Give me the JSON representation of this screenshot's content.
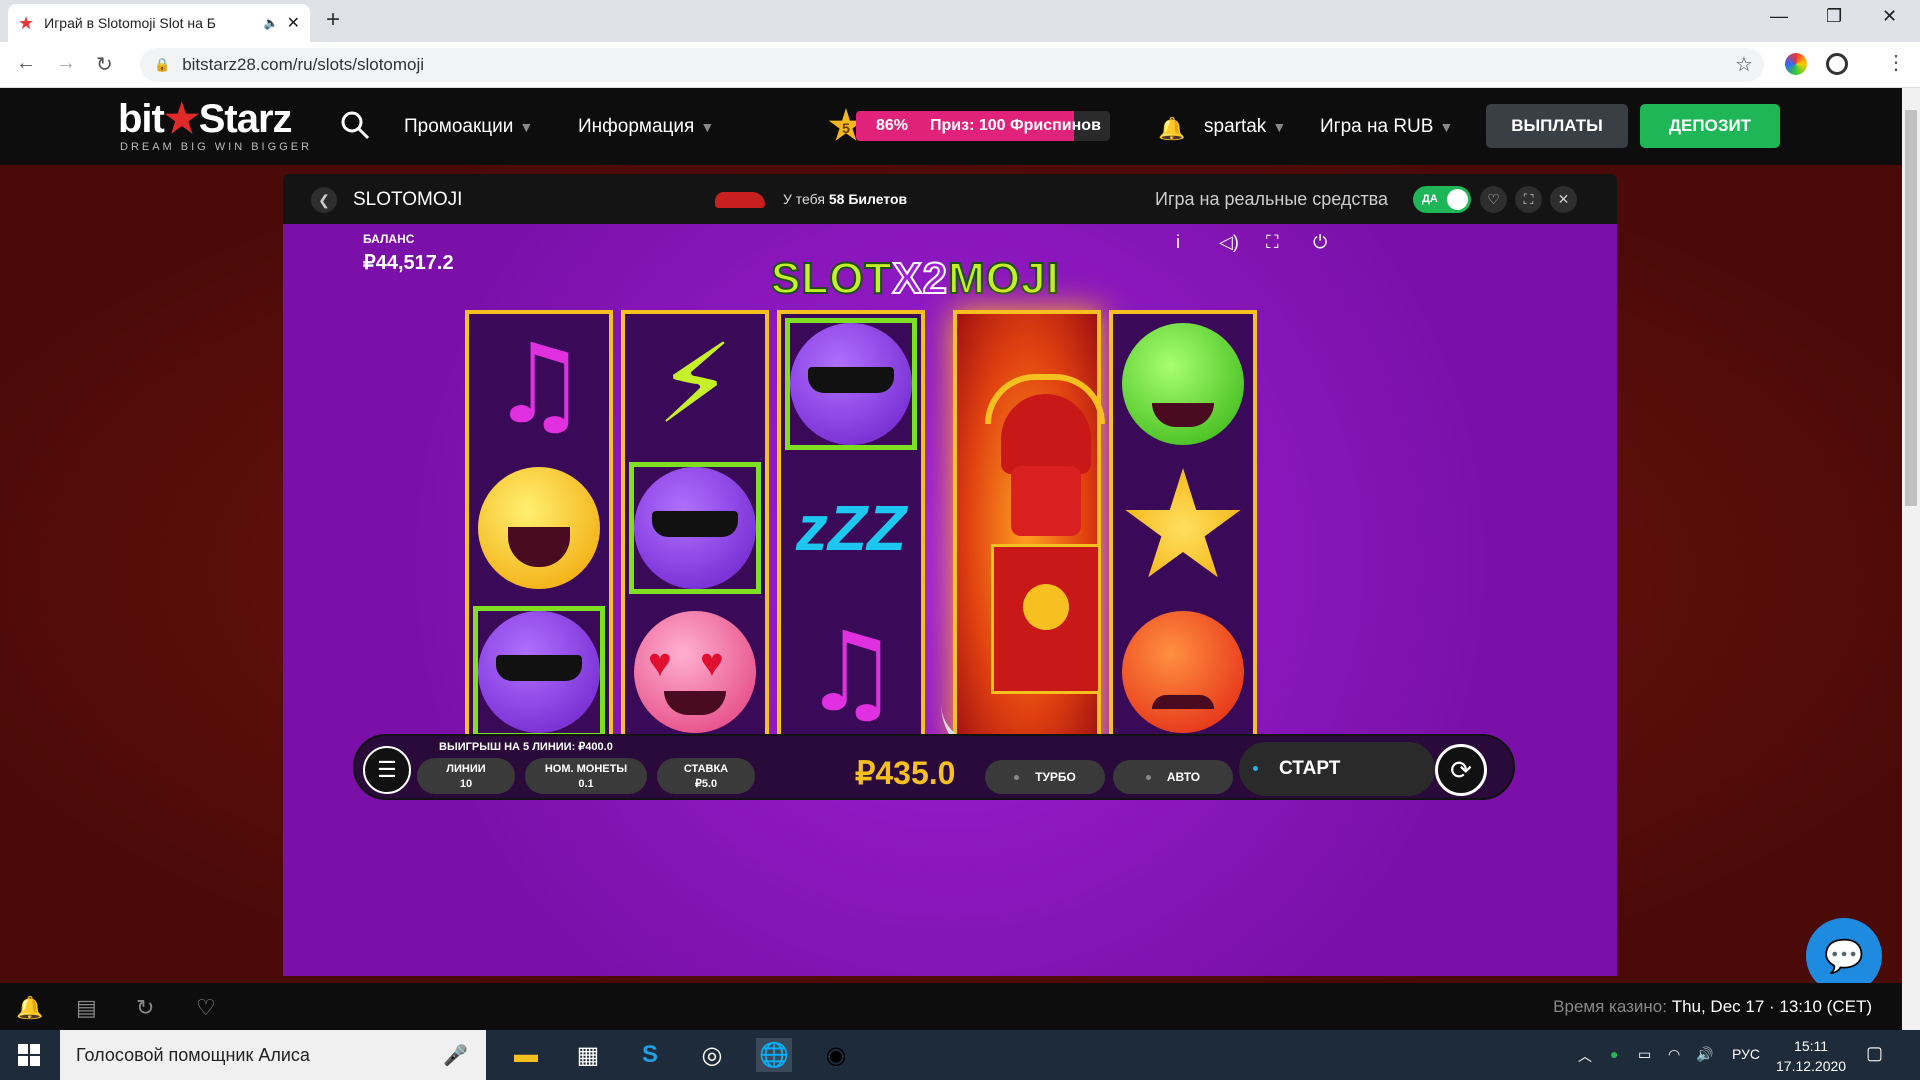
{
  "browser": {
    "tab_title": "Играй в Slotomoji Slot на Б",
    "url": "bitstarz28.com/ru/slots/slotomoji",
    "new_tab": "+",
    "win_min": "—",
    "win_max": "❐",
    "win_close": "✕"
  },
  "site": {
    "logo_a": "bit",
    "logo_b": "Starz",
    "logo_tag": "DREAM BIG WIN BIGGER",
    "menu_promo": "Промоакции",
    "menu_info": "Информация",
    "level": "5",
    "progress_pct": 86,
    "progress_text": "86%",
    "prize_text": "Приз: 100 Фриспинов",
    "username": "spartak",
    "currency": "Игра на RUB",
    "payouts": "ВЫПЛАТЫ",
    "deposit": "ДЕПОЗИТ"
  },
  "gamebar": {
    "title": "SLOTOMOJI",
    "tickets_prefix": "У тебя",
    "tickets_count": "58 Билетов",
    "real_money": "Игра на реальные средства",
    "toggle": "ДА"
  },
  "game": {
    "balance_label": "БАЛАНС",
    "balance_value": "₽44,517.2",
    "logo_left": "SLOT",
    "logo_mid": "X2",
    "logo_right": "MOJI",
    "win_line": "ВЫИГРЫШ НА 5 ЛИНИИ: ₽400.0",
    "lines_label": "ЛИНИИ",
    "lines_value": "10",
    "coin_label": "НОМ. МОНЕТЫ",
    "coin_value": "0.1",
    "bet_label": "СТАВКА",
    "bet_value": "₽5.0",
    "total_win": "₽435.0",
    "turbo": "ТУРБО",
    "auto": "АВТО",
    "start": "СТАРТ"
  },
  "footer": {
    "casino_time_label": "Время казино:",
    "casino_time_value": "Thu, Dec 17 · 13:10 (CET)"
  },
  "taskbar": {
    "search_text": "Голосовой помощник Алиса",
    "lang": "РУС",
    "time": "15:11",
    "date": "17.12.2020"
  },
  "colors": {
    "accent_green": "#1fb657",
    "progress_pink": "#e0227b",
    "reel_gold": "#f5c020",
    "game_purple": "#8a16b8"
  }
}
